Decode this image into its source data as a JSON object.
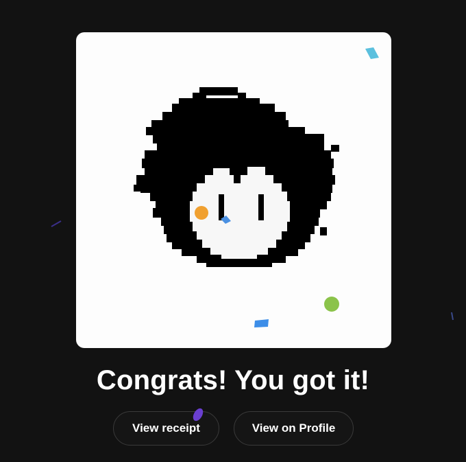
{
  "headline": "Congrats! You got it!",
  "buttons": {
    "view_receipt": "View receipt",
    "view_profile": "View on Profile"
  },
  "colors": {
    "background": "#121212",
    "card": "#fdfdfd",
    "button_border": "#3a3a3a",
    "confetti": [
      "#f0a030",
      "#4a90e2",
      "#8bc34a",
      "#5bc0de",
      "#6a3fd0"
    ]
  },
  "artwork": {
    "icon": "pixel-art-avatar"
  }
}
